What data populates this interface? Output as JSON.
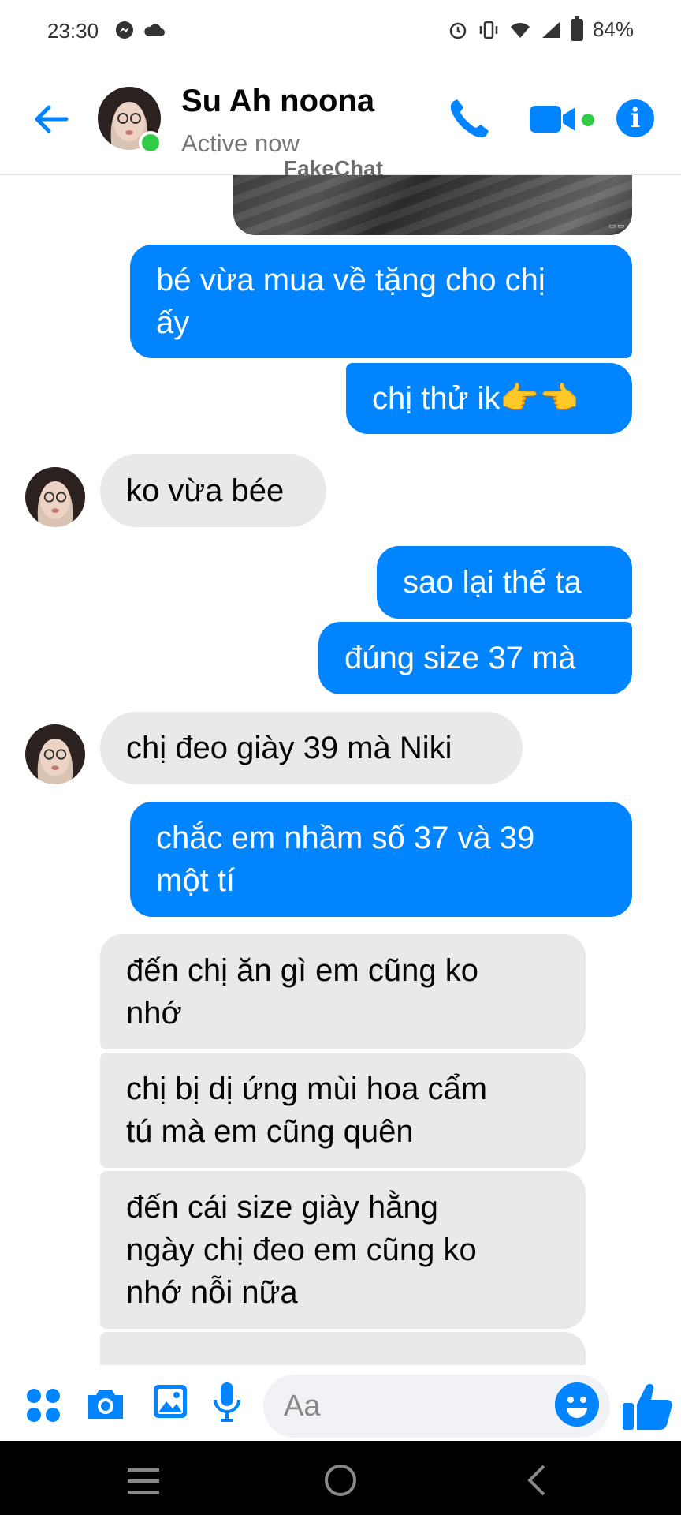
{
  "status_bar": {
    "time": "23:30",
    "battery": "84%",
    "icons": [
      "messenger-icon",
      "cloud-icon",
      "alarm-icon",
      "vibrate-icon",
      "wifi-icon",
      "signal-icon",
      "battery-icon"
    ]
  },
  "header": {
    "contact_name": "Su Ah noona",
    "status": "Active now",
    "watermark": "FakeChat",
    "accent_color": "#0084ff",
    "online_color": "#31cc46"
  },
  "messages": [
    {
      "side": "out",
      "text": "bé vừa mua về tặng cho chị\nấy"
    },
    {
      "side": "out",
      "text": "chị thử ik👉👈"
    },
    {
      "side": "in",
      "text": "ko vừa béе"
    },
    {
      "side": "out",
      "text": "sao lại thế ta"
    },
    {
      "side": "out",
      "text": "đúng size 37 mà"
    },
    {
      "side": "in",
      "text": "chị đeo giày 39 mà Niki"
    },
    {
      "side": "out",
      "text": "chắc em nhầm số 37 và 39\nmột tí"
    },
    {
      "side": "in",
      "text": "đến chị ăn gì em cũng ko\nnhớ"
    },
    {
      "side": "in",
      "text": "chị bị dị ứng mùi hoa cẩm\ntú mà em cũng quên"
    },
    {
      "side": "in",
      "text": "đến cái size giày hằng\nngày chị đeo em cũng ko\nnhớ nỗi nữa"
    }
  ],
  "composer": {
    "placeholder": "Aa"
  }
}
